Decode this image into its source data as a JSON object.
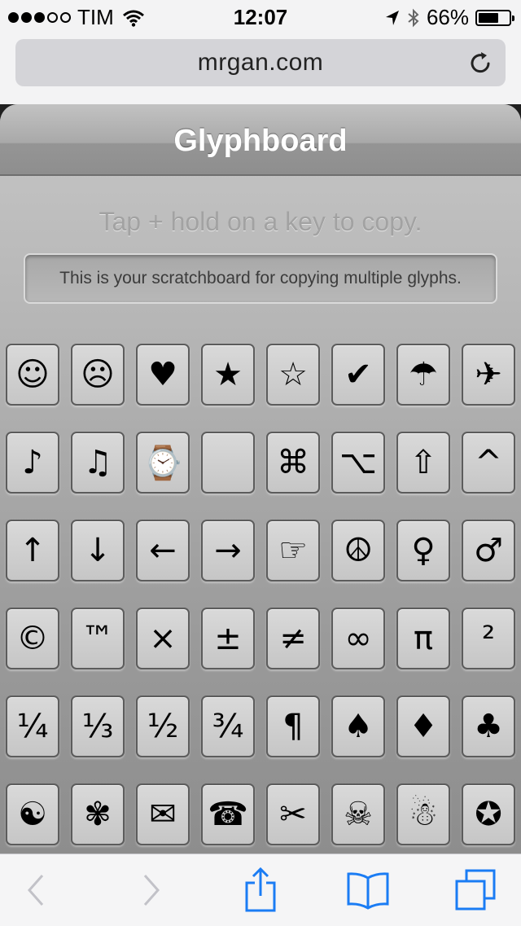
{
  "status_bar": {
    "signal_dots": [
      true,
      true,
      true,
      false,
      false
    ],
    "carrier": "TIM",
    "time": "12:07",
    "battery": "66%",
    "battery_level": 0.66
  },
  "address_bar": {
    "url": "mrgan.com",
    "reload_icon": "reload-icon"
  },
  "app": {
    "title": "Glyphboard",
    "hint": "Tap + hold on a key to copy.",
    "scratchboard_text": "This is your scratchboard for copying multiple glyphs."
  },
  "glyph_rows": [
    [
      "☺",
      "☹",
      "♥",
      "★",
      "☆",
      "✔",
      "☂",
      "✈"
    ],
    [
      "♪",
      "♫",
      "⌚",
      "",
      "⌘",
      "⌥",
      "⇧",
      "^"
    ],
    [
      "↑",
      "↓",
      "←",
      "→",
      "☞",
      "☮",
      "♀",
      "♂"
    ],
    [
      "©",
      "™",
      "×",
      "±",
      "≠",
      "∞",
      "π",
      "²"
    ],
    [
      "¼",
      "⅓",
      "½",
      "¾",
      "¶",
      "♠",
      "♦",
      "♣"
    ],
    [
      "☯",
      "✾",
      "✉",
      "☎",
      "✂",
      "☠",
      "☃",
      "✪"
    ]
  ],
  "toolbar": {
    "buttons": [
      {
        "name": "back-icon",
        "enabled": false
      },
      {
        "name": "forward-icon",
        "enabled": false
      },
      {
        "name": "share-icon",
        "enabled": true
      },
      {
        "name": "bookmarks-icon",
        "enabled": true
      },
      {
        "name": "tabs-icon",
        "enabled": true
      }
    ]
  },
  "colors": {
    "accent": "#1a7cf4",
    "disabled": "#c2c2c8"
  }
}
